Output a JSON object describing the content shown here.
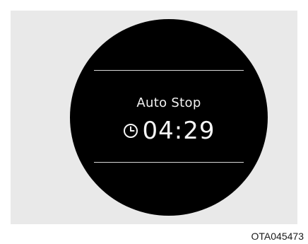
{
  "display": {
    "title": "Auto Stop",
    "timer": "04:29",
    "icon": "clock-icon"
  },
  "figure_code": "OTA045473",
  "colors": {
    "background_panel": "#e9e9e9",
    "dial": "#000000",
    "text": "#f2f2f2",
    "rule": "#d8d8d8"
  }
}
